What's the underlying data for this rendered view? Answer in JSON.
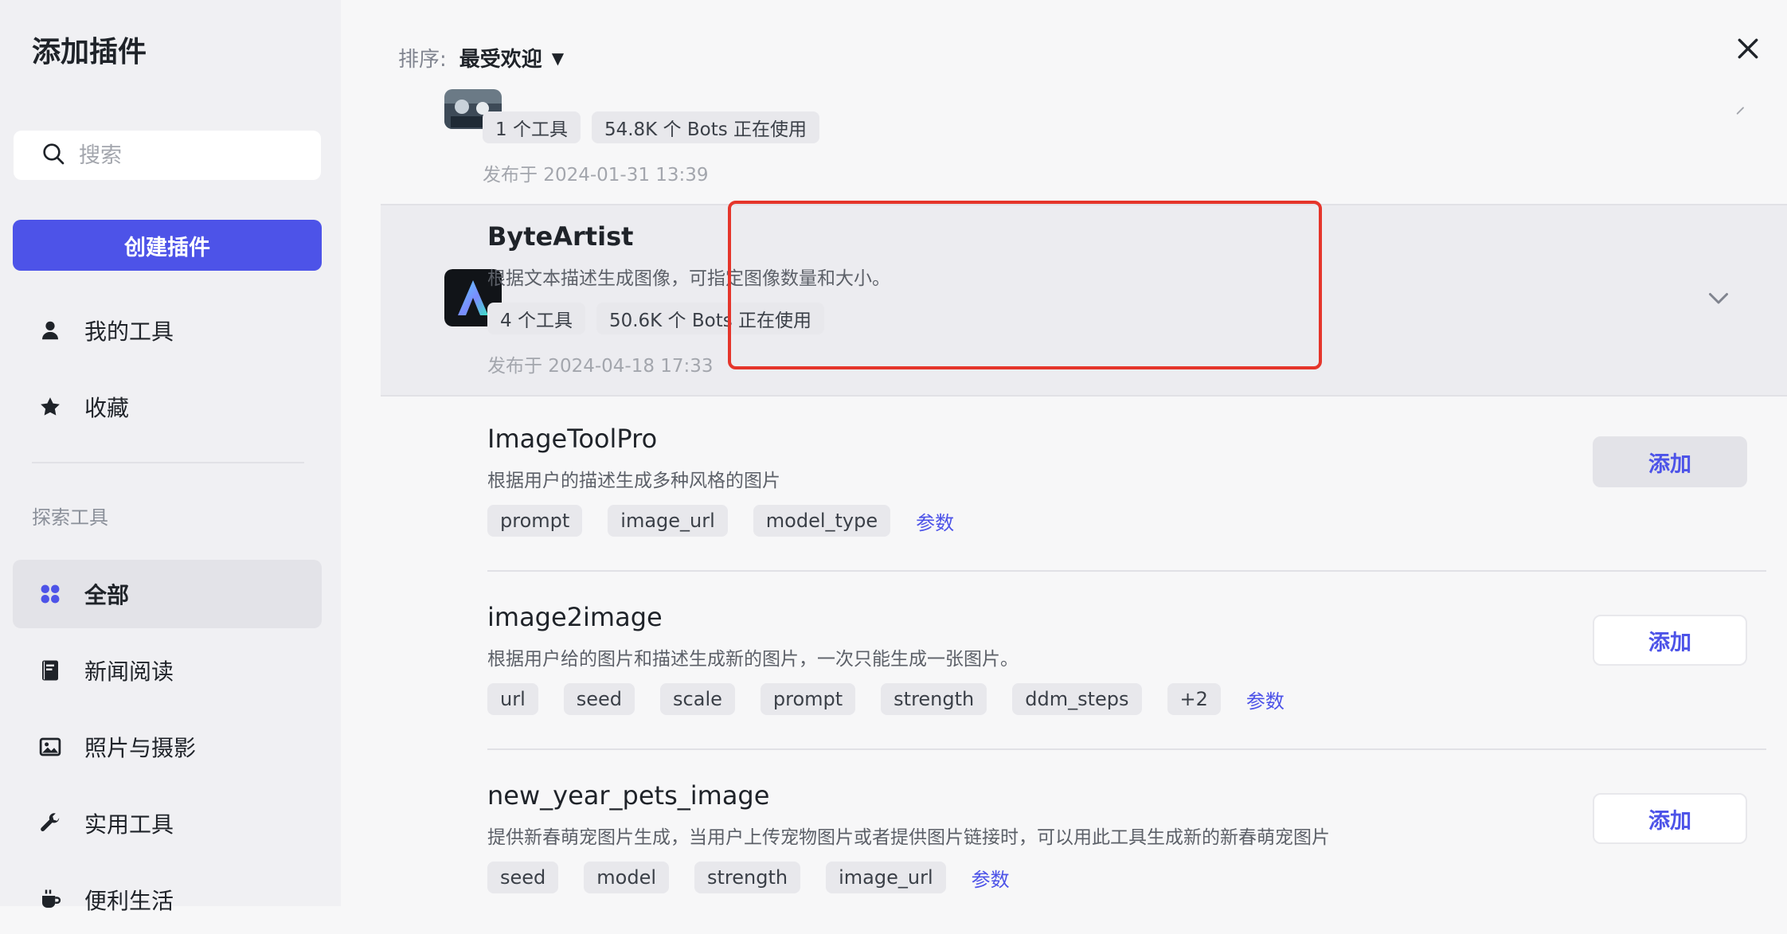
{
  "sidebar": {
    "title": "添加插件",
    "search_placeholder": "搜索",
    "create_label": "创建插件",
    "my_tools": "我的工具",
    "favorites": "收藏",
    "section_label": "探索工具",
    "categories": [
      "全部",
      "新闻阅读",
      "照片与摄影",
      "实用工具",
      "便利生活"
    ],
    "active_category": "全部"
  },
  "main": {
    "sort_label": "排序:",
    "sort_value": "最受欢迎",
    "plugins": [
      {
        "tools_count": "1 个工具",
        "bots_usage": "54.8K 个 Bots 正在使用",
        "published": "发布于 2024-01-31 13:39"
      },
      {
        "name": "ByteArtist",
        "description": "根据文本描述生成图像，可指定图像数量和大小。",
        "tools_count": "4 个工具",
        "bots_usage": "50.6K 个 Bots 正在使用",
        "published": "发布于 2024-04-18 17:33"
      }
    ],
    "tools": [
      {
        "name": "ImageToolPro",
        "description": "根据用户的描述生成多种风格的图片",
        "params": [
          "prompt",
          "image_url",
          "model_type"
        ],
        "params_link": "参数",
        "add_label": "添加"
      },
      {
        "name": "image2image",
        "description": "根据用户给的图片和描述生成新的图片，一次只能生成一张图片。",
        "params": [
          "url",
          "seed",
          "scale",
          "prompt",
          "strength",
          "ddm_steps",
          "+2"
        ],
        "params_link": "参数",
        "add_label": "添加"
      },
      {
        "name": "new_year_pets_image",
        "description": "提供新春萌宠图片生成，当用户上传宠物图片或者提供图片链接时，可以用此工具生成新的新春萌宠图片",
        "params": [
          "seed",
          "model",
          "strength",
          "image_url"
        ],
        "params_link": "参数",
        "add_label": "添加"
      }
    ]
  },
  "colors": {
    "accent": "#4d53e8",
    "highlight_border": "#e5352b",
    "sidebar_bg": "#f0f0f3"
  }
}
